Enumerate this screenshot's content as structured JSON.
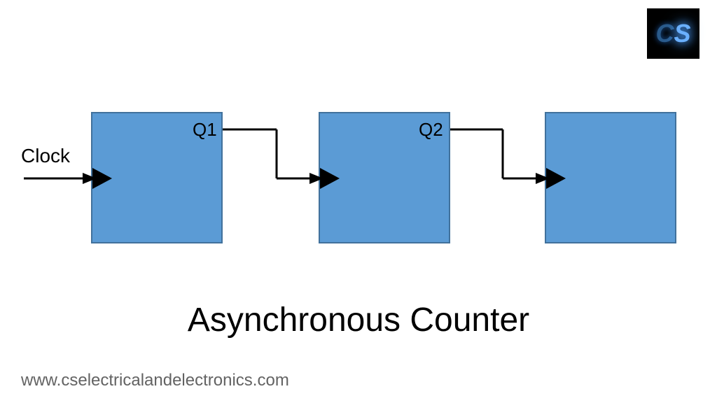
{
  "diagram": {
    "title": "Asynchronous Counter",
    "clock_label": "Clock",
    "outputs": {
      "q1": "Q1",
      "q2": "Q2"
    },
    "block_color": "#5b9bd5",
    "block_border": "#41719c"
  },
  "logo": {
    "letter1": "C",
    "letter2": "S"
  },
  "website": "www.cselectricalandelectronics.com"
}
